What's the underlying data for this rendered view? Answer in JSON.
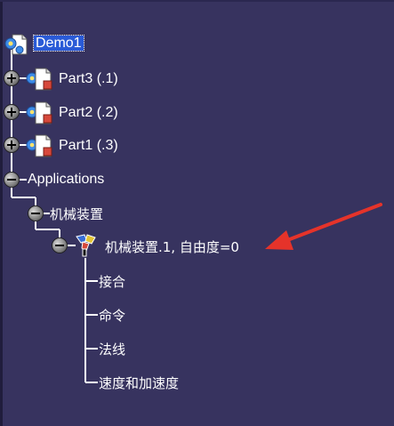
{
  "tree": {
    "root": {
      "label": "Demo1",
      "selected": true
    },
    "parts": [
      {
        "label": "Part3 (.1)"
      },
      {
        "label": "Part2 (.2)"
      },
      {
        "label": "Part1 (.3)"
      }
    ],
    "applications": {
      "label": "Applications"
    },
    "mechanism_group": {
      "label": "机械装置"
    },
    "mechanism": {
      "label": "机械装置.1, 自由度=0"
    },
    "mechanism_children": [
      {
        "label": "接合"
      },
      {
        "label": "命令"
      },
      {
        "label": "法线"
      },
      {
        "label": "速度和加速度"
      }
    ]
  },
  "colors": {
    "background": "#37335f",
    "selection": "#2a5bd7",
    "annotation_arrow": "#e5332a"
  },
  "icons": {
    "product": "product-document-icon",
    "part": "part-document-icon",
    "mechanism": "mechanism-icon",
    "expand": "plus-icon",
    "collapse": "minus-icon"
  }
}
